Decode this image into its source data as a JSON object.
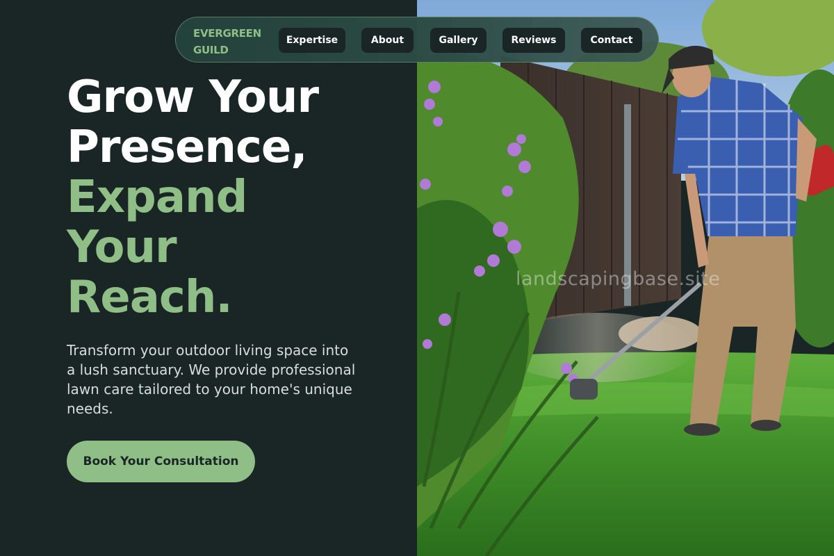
{
  "nav": {
    "brand_line1": "EVERGREEN",
    "brand_line2": "GUILD",
    "links": [
      "Expertise",
      "About",
      "Gallery",
      "Reviews",
      "Contact"
    ]
  },
  "hero": {
    "headline_line1": "Grow Your",
    "headline_line2": "Presence,",
    "headline_line3": "Expand",
    "headline_line4": "Your",
    "headline_line5": "Reach.",
    "description": "Transform your outdoor living space into a lush sanctuary. We provide professional lawn care tailored to your home's unique needs.",
    "cta_label": "Book Your Consultation"
  },
  "photo": {
    "watermark": "landscapingbase.site"
  },
  "colors": {
    "background": "#1a2625",
    "accent": "#8fbf87",
    "text": "#ffffff"
  }
}
